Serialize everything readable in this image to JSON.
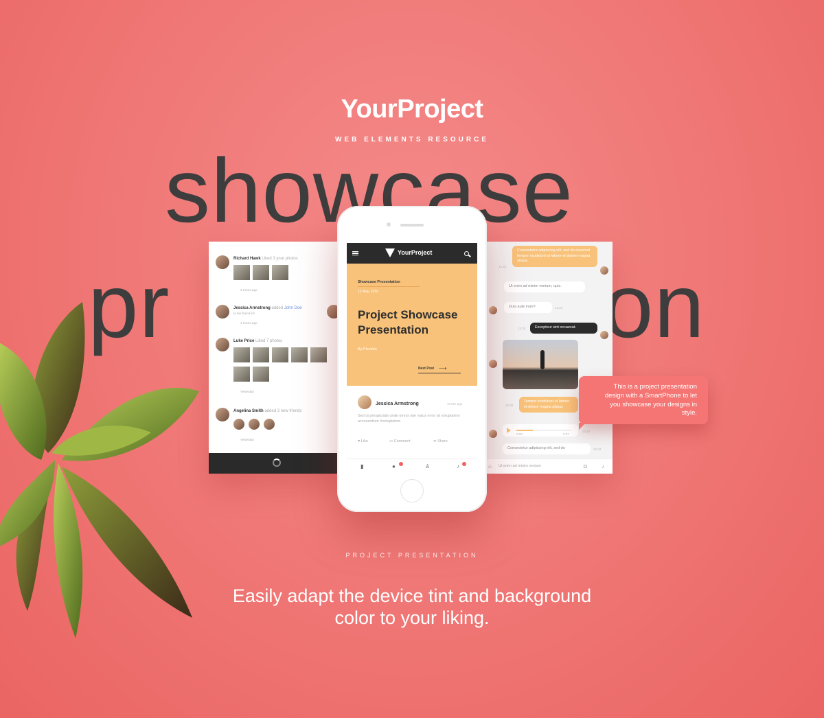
{
  "brand": {
    "name": "YourProject",
    "subtitle": "WEB ELEMENTS RESOURCE"
  },
  "headline": {
    "word1": "showcase",
    "word2_left": "pr",
    "word2_right": "on"
  },
  "feed_card": {
    "items": [
      {
        "name": "Richard Hawk",
        "action": "Liked 3 your photos",
        "time": "3 Hours ago"
      },
      {
        "name": "Jessica Armstrong",
        "action": "added",
        "target": "John Doe",
        "sub": "to her friend list",
        "time": "4 Hours ago"
      },
      {
        "name": "Luke Price",
        "action": "Liked 7 photos",
        "time": "Yesterday"
      },
      {
        "name": "Angelina Smith",
        "action": "added 3 new friends",
        "time": "Yesterday"
      }
    ]
  },
  "phone": {
    "app_title": "YourProject",
    "hero": {
      "category": "Showcase Presentation",
      "date": "12 May, 2016",
      "title": "Project Showcase Presentation",
      "author": "By Pixeden",
      "next_label": "Next Post"
    },
    "post": {
      "author": "Jessica Armstrong",
      "time": "10 Min ago",
      "text": "Sed ut perspiciatis unde omnis iste natus error sit voluptatem accusantium #voluptatem"
    },
    "actions": {
      "like": "Like",
      "comment": "Comment",
      "share": "Share"
    },
    "tab_badges": {
      "chat": "1",
      "mic": "1"
    }
  },
  "chat_card": {
    "messages": [
      {
        "text": "Consectetur adipiscing elit, sed do eiusmod tempor incididunt ut labore et dolore magna aliqua.",
        "style": "orange"
      },
      {
        "text": "Ut enim ad minim veniam, quis.",
        "style": "white"
      },
      {
        "text": "Duis aute irure?",
        "style": "white"
      },
      {
        "text": "Excepteur sint occaecat.",
        "style": "dark"
      },
      {
        "text": "Tempor incididunt ut labore et dolore magna aliqua.",
        "style": "orange"
      },
      {
        "text": "Consectetur adipiscing elit, sed do",
        "style": "white"
      }
    ],
    "times": [
      "12:20",
      "12:22",
      "12:25",
      "12:30",
      "12:32",
      "12:34"
    ],
    "audio_time_start": "0:00",
    "audio_time_end": "0:37",
    "input_placeholder": "Ut enim ad minim veniam"
  },
  "tooltip": {
    "text": "This is a project presentation design with a SmartPhone to let you showcase your designs in style."
  },
  "section_label": "PROJECT PRESENTATION",
  "tagline": {
    "line1": "Easily adapt the device tint and background",
    "line2": "color to your liking."
  },
  "colors": {
    "background": "#f07a78",
    "accent_orange": "#f8c27a",
    "dark": "#2b2b2b",
    "tooltip": "#f47573"
  }
}
